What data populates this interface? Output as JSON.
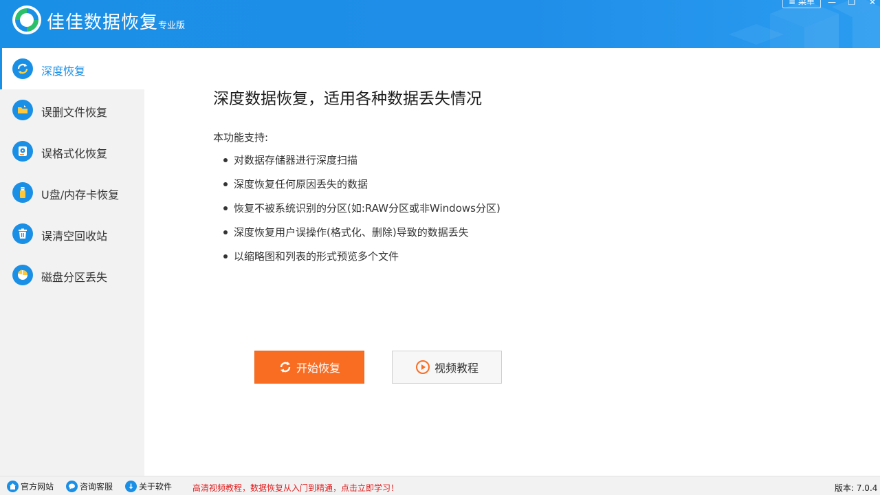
{
  "header": {
    "title": "佳佳数据恢复",
    "edition": "专业版",
    "menu_label": "菜单",
    "min_glyph": "—",
    "max_glyph": "❐",
    "close_glyph": "✕"
  },
  "sidebar": {
    "items": [
      {
        "label": "深度恢复",
        "icon": "refresh-icon",
        "active": true
      },
      {
        "label": "误删文件恢复",
        "icon": "folder-icon",
        "active": false
      },
      {
        "label": "误格式化恢复",
        "icon": "disk-icon",
        "active": false
      },
      {
        "label": "U盘/内存卡恢复",
        "icon": "usb-icon",
        "active": false
      },
      {
        "label": "误清空回收站",
        "icon": "trash-icon",
        "active": false
      },
      {
        "label": "磁盘分区丢失",
        "icon": "pie-icon",
        "active": false
      }
    ]
  },
  "main": {
    "title": "深度数据恢复，适用各种数据丢失情况",
    "support_label": "本功能支持:",
    "features": [
      "对数据存储器进行深度扫描",
      "深度恢复任何原因丢失的数据",
      "恢复不被系统识别的分区(如:RAW分区或非Windows分区)",
      "深度恢复用户误操作(格式化、删除)导致的数据丢失",
      "以缩略图和列表的形式预览多个文件"
    ],
    "start_button": "开始恢复",
    "video_button": "视频教程"
  },
  "footer": {
    "website": "官方网站",
    "support": "咨询客服",
    "about": "关于软件",
    "promo": "高清视频教程，数据恢复从入门到精通，点击立即学习！",
    "version": "版本: 7.0.4"
  },
  "colors": {
    "brand_blue": "#1a8fe6",
    "start_orange": "#f96d23",
    "promo_red": "#e02020"
  }
}
